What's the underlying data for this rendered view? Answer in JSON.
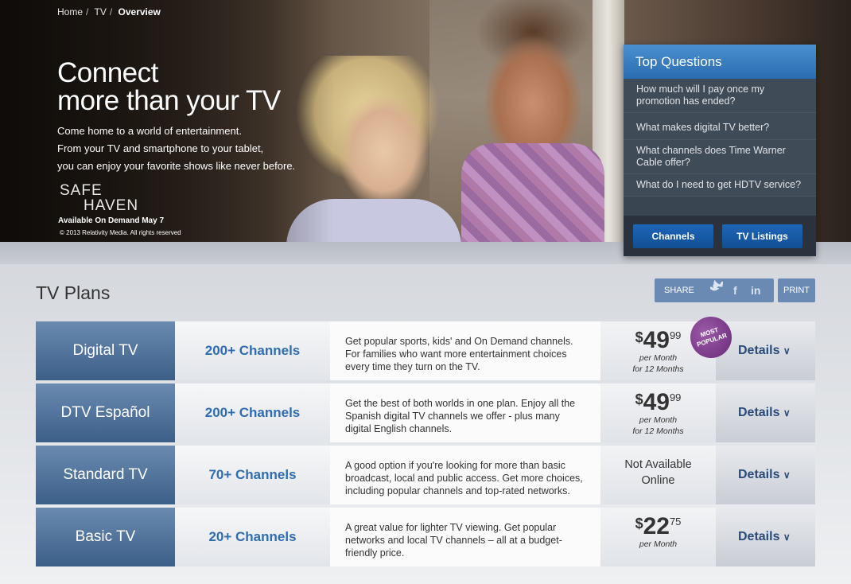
{
  "breadcrumb": [
    "Home",
    "TV",
    "Overview"
  ],
  "hero": {
    "title_line1": "Connect",
    "title_line2": "more than your TV",
    "subtitle_line1": "Come home to a world of entertainment.",
    "subtitle_line2": "From your TV and smartphone to your tablet,",
    "subtitle_line3": "you can enjoy your favorite shows like never before.",
    "movie_line1": "SAFE",
    "movie_line2": "HAVEN",
    "availability": "Available On Demand May 7",
    "copyright": "© 2013 Relativity Media. All rights reserved"
  },
  "top_questions": {
    "title": "Top Questions",
    "items": [
      "How much will I pay once my promotion has ended?",
      "What makes digital TV better?",
      "What channels does Time Warner Cable offer?",
      "What do I need to get HDTV service?"
    ],
    "channels_button": "Channels",
    "listings_button": "TV Listings"
  },
  "plans": {
    "title": "TV Plans",
    "share_label": "SHARE",
    "print_label": "PRINT",
    "badge": "MOST POPULAR",
    "rows": [
      {
        "name": "Digital TV",
        "channels": "200+ Channels",
        "desc": "Get popular sports, kids' and On Demand channels. For families who want more entertainment choices every time they turn on the TV.",
        "dollar": "$",
        "amount": "49",
        "cents": "99",
        "note1": "per Month",
        "note2": "for 12 Months",
        "details": "Details"
      },
      {
        "name": "DTV Español",
        "channels": "200+ Channels",
        "desc": "Get the best of both worlds in one plan. Enjoy all the Spanish digital TV channels we offer - plus many digital English channels.",
        "dollar": "$",
        "amount": "49",
        "cents": "99",
        "note1": "per Month",
        "note2": "for 12 Months",
        "details": "Details"
      },
      {
        "name": "Standard TV",
        "channels": "70+ Channels",
        "desc": "A good option if you're looking for more than basic broadcast, local and public access. Get more choices, including popular channels and top-rated networks.",
        "na1": "Not Available",
        "na2": "Online",
        "details": "Details"
      },
      {
        "name": "Basic TV",
        "channels": "20+ Channels",
        "desc": "A great value for lighter TV viewing. Get popular networks and local TV channels – all at a budget-friendly price.",
        "dollar": "$",
        "amount": "22",
        "cents": "75",
        "note1": "per Month",
        "details": "Details"
      }
    ]
  },
  "colors": {
    "accent": "#2f6cb0",
    "plan_name_bg": "#4a6c94",
    "panel_head": "#3a7cc0",
    "badge": "#7a3a88"
  }
}
